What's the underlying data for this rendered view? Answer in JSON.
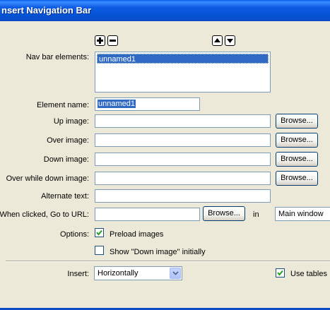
{
  "window": {
    "title": "nsert Navigation Bar"
  },
  "nav_elements": {
    "label": "Nav bar elements:",
    "items": [
      "unnamed1"
    ]
  },
  "element_name": {
    "label": "Element name:",
    "value": "unnamed1"
  },
  "up_image": {
    "label": "Up image:",
    "value": ""
  },
  "over_image": {
    "label": "Over image:",
    "value": ""
  },
  "down_image": {
    "label": "Down image:",
    "value": ""
  },
  "over_while_down_image": {
    "label": "Over while down image:",
    "value": ""
  },
  "alternate_text": {
    "label": "Alternate text:",
    "value": ""
  },
  "go_to_url": {
    "label": "When clicked, Go to URL:",
    "value": "",
    "in_label": "in",
    "target": "Main window"
  },
  "browse_label": "Browse...",
  "options": {
    "label": "Options:",
    "preload_images": {
      "label": "Preload images",
      "checked": true
    },
    "show_down_initially": {
      "label": "Show \"Down image\" initially",
      "checked": false
    }
  },
  "insert": {
    "label": "Insert:",
    "value": "Horizontally"
  },
  "use_tables": {
    "label": "Use tables",
    "checked": true
  },
  "colors": {
    "title_bar": "#0454D6",
    "dialog_bg": "#ECE9D8",
    "selection": "#316AC5"
  }
}
